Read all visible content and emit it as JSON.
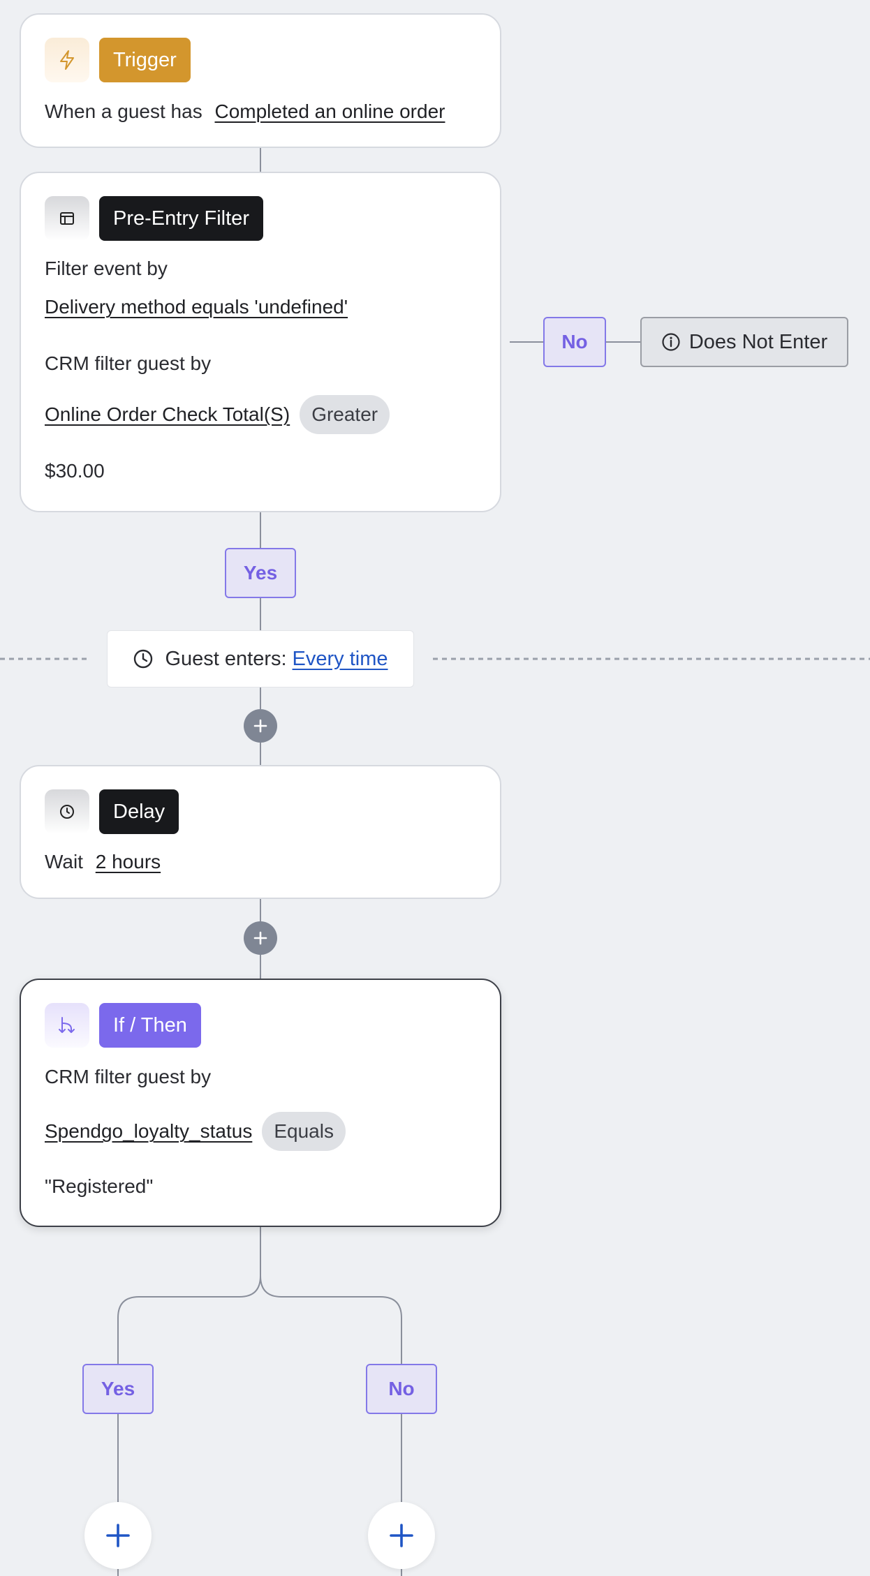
{
  "trigger": {
    "title": "Trigger",
    "prefix": "When a guest has",
    "event": "Completed an online order"
  },
  "pre_entry": {
    "title": "Pre-Entry Filter",
    "event_label": "Filter event by",
    "event_filter": "Delivery method equals 'undefined'",
    "crm_label": "CRM filter guest by",
    "field": "Online Order Check Total(S)",
    "operator": "Greater",
    "value": "$30.00",
    "yes_label": "Yes",
    "no_label": "No",
    "no_outcome": "Does Not Enter"
  },
  "entry": {
    "label": "Guest enters:",
    "value": "Every time"
  },
  "delay": {
    "title": "Delay",
    "prefix": "Wait",
    "duration": "2 hours"
  },
  "if_then": {
    "title": "If / Then",
    "crm_label": "CRM filter guest by",
    "field": "Spendgo_loyalty_status",
    "operator": "Equals",
    "value": "\"Registered\"",
    "yes_label": "Yes",
    "no_label": "No"
  },
  "colors": {
    "trigger_accent": "#d3962d",
    "dark_accent": "#18191c",
    "purple_accent": "#7b69ec",
    "branch_tag_text": "#7460e3",
    "link_blue": "#1f55c5",
    "canvas_bg": "#eef0f3"
  },
  "icons": {
    "trigger": "lightning-icon",
    "pre_entry": "layout-icon",
    "delay": "clock-icon",
    "if_then": "branch-arrows-icon",
    "outcome": "info-icon",
    "entry": "clock-icon",
    "add": "plus-icon"
  }
}
